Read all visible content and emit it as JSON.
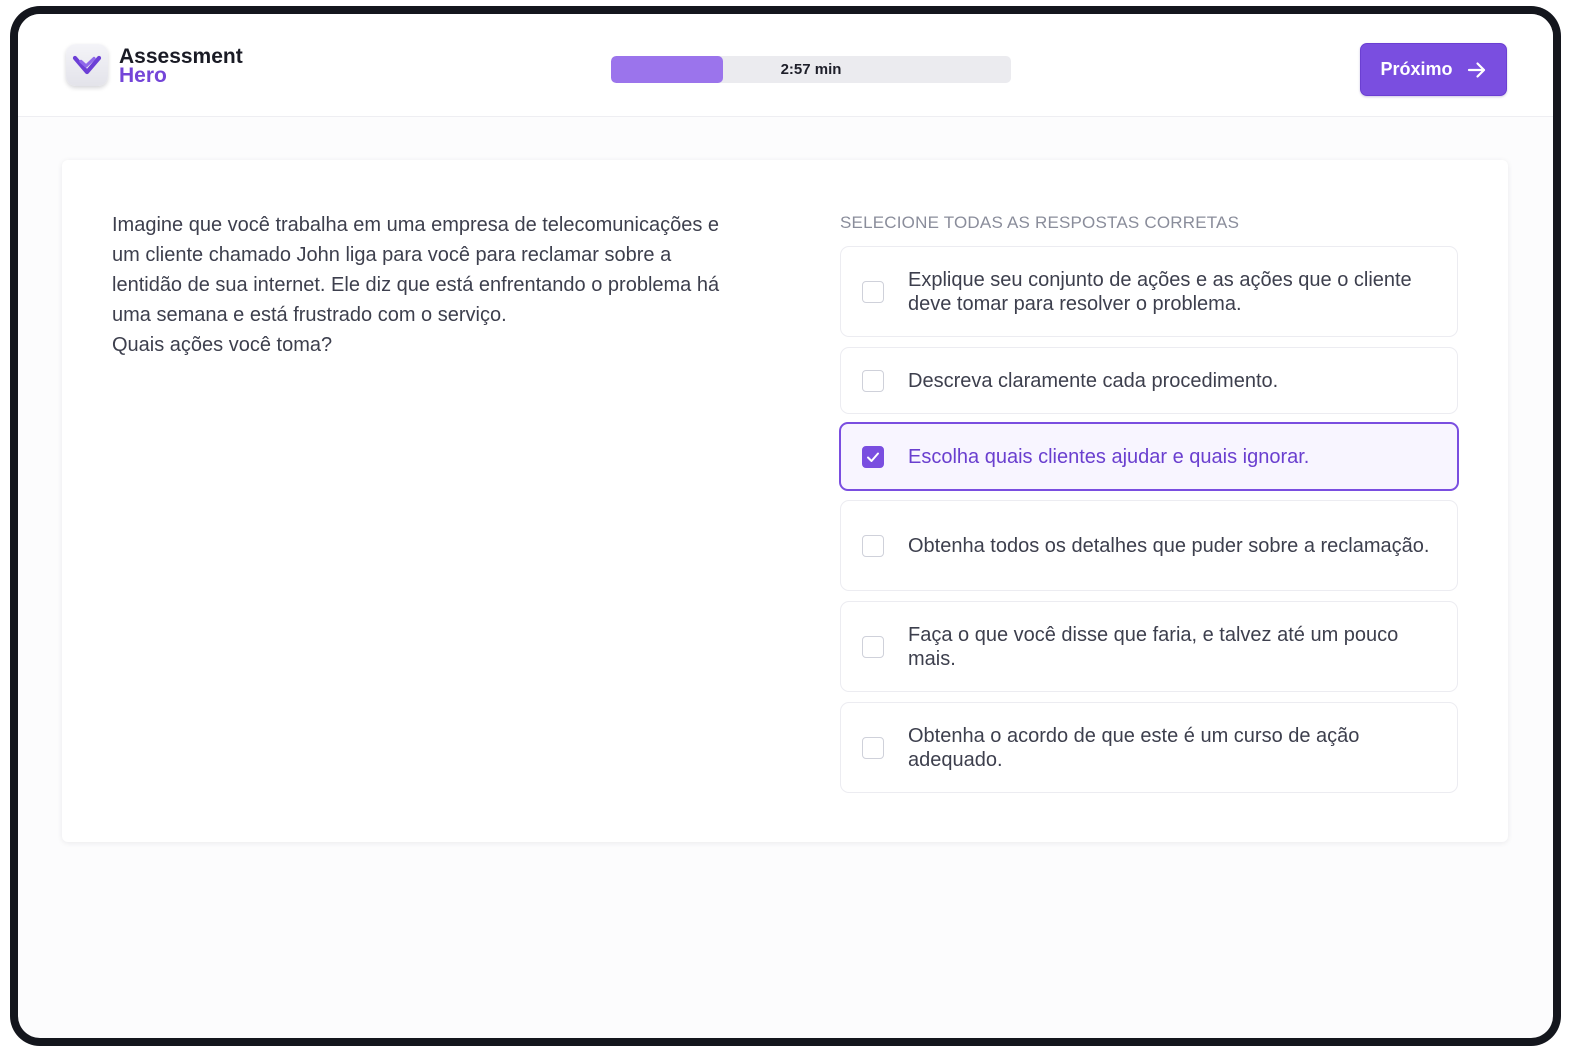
{
  "header": {
    "logo_line1": "Assessment",
    "logo_line2": "Hero",
    "timer_label": "2:57 min",
    "progress_fraction": 0.28,
    "next_label": "Próximo"
  },
  "question": {
    "text_lines": [
      "Imagine que você trabalha em uma empresa de telecomunicações e um cliente chamado John liga para você para reclamar sobre a lentidão de sua internet. Ele diz que está enfrentando o problema há uma semana e está frustrado com o serviço.",
      "Quais ações você toma?"
    ]
  },
  "answers": {
    "instruction": "SELECIONE TODAS AS RESPOSTAS CORRETAS",
    "options": [
      {
        "label": "Explique seu conjunto de ações e as ações que o cliente deve tomar para resolver o problema.",
        "selected": false
      },
      {
        "label": "Descreva claramente cada procedimento.",
        "selected": false
      },
      {
        "label": "Escolha quais clientes ajudar e quais ignorar.",
        "selected": true
      },
      {
        "label": "Obtenha todos os detalhes que puder sobre a reclamação.",
        "selected": false
      },
      {
        "label": "Faça o que você disse que faria, e talvez até um pouco mais.",
        "selected": false
      },
      {
        "label": "Obtenha o acordo de que este é um curso de ação adequado.",
        "selected": false
      }
    ]
  },
  "colors": {
    "accent": "#7a4ee0",
    "progress_fill": "#9b74ec",
    "selected_bg": "#f8f5ff"
  },
  "icons": {
    "logo": "check-badge-icon",
    "next": "arrow-right-icon",
    "checked": "check-icon"
  }
}
